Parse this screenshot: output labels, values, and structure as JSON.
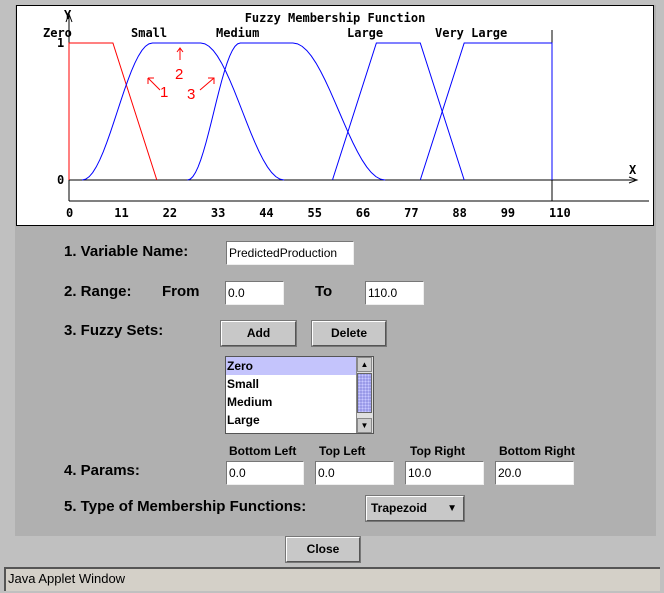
{
  "chart_data": {
    "type": "line",
    "title": "Fuzzy Membership Function",
    "xlabel": "X",
    "ylabel": "Y",
    "xlim": [
      0,
      110
    ],
    "ylim": [
      0,
      1
    ],
    "x_ticks": [
      "0",
      "11",
      "22",
      "33",
      "44",
      "55",
      "66",
      "77",
      "88",
      "99",
      "110"
    ],
    "y_ticks": [
      "0",
      "1"
    ],
    "grid": false,
    "series": [
      {
        "name": "Zero",
        "shape": "trapezoid",
        "points": [
          0,
          0,
          10,
          20
        ],
        "color": "#ff0000"
      },
      {
        "name": "Small",
        "shape": "s-curve",
        "points": [
          3,
          19,
          30,
          49
        ],
        "color": "#0000ff"
      },
      {
        "name": "Medium",
        "shape": "s-curve",
        "points": [
          27,
          39,
          51,
          72
        ],
        "color": "#0000ff"
      },
      {
        "name": "Large",
        "shape": "trapezoid",
        "points": [
          60,
          70,
          80,
          90
        ],
        "color": "#0000ff"
      },
      {
        "name": "Very Large",
        "shape": "trapezoid",
        "points": [
          80,
          90,
          110,
          110
        ],
        "color": "#0000ff"
      }
    ],
    "annotations": [
      "1",
      "2",
      "3"
    ],
    "annotation_color": "#ff0000"
  },
  "form": {
    "variable_name_label": "1.  Variable Name:",
    "variable_name_value": "PredictedProduction",
    "range_label": "2.  Range:",
    "from_label": "From",
    "from_value": "0.0",
    "to_label": "To",
    "to_value": "110.0",
    "fuzzy_sets_label": "3.  Fuzzy Sets:",
    "add_label": "Add",
    "delete_label": "Delete",
    "fuzzy_sets": [
      "Zero",
      "Small",
      "Medium",
      "Large"
    ],
    "selected_set": "Zero",
    "params_label": "4.  Params:",
    "params": [
      {
        "label": "Bottom Left",
        "value": "0.0"
      },
      {
        "label": "Top Left",
        "value": "0.0"
      },
      {
        "label": "Top Right",
        "value": "10.0"
      },
      {
        "label": "Bottom Right",
        "value": "20.0"
      }
    ],
    "type_label": "5.  Type of Membership Functions:",
    "type_value": "Trapezoid"
  },
  "close_label": "Close",
  "status_text": "Java Applet Window"
}
